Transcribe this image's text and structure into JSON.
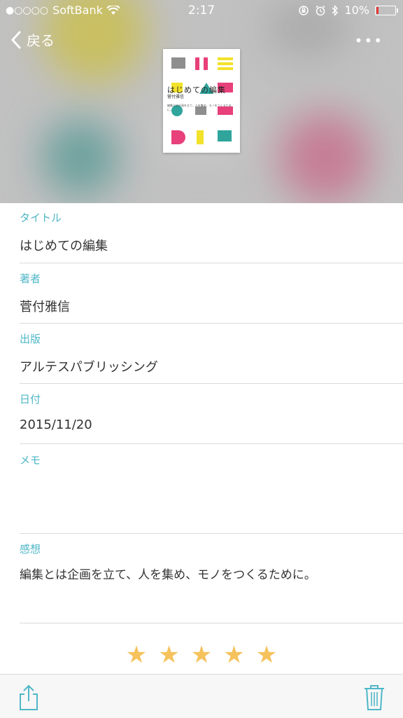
{
  "status_bar": {
    "carrier": "SoftBank",
    "time": "2:17",
    "battery": "10%",
    "battery_level": 0.1,
    "battery_color": "#e53935"
  },
  "nav": {
    "back_label": "戻る",
    "more_label": "•••"
  },
  "cover": {
    "title": "はじめての編集",
    "author": "菅付雅信",
    "caption": "編集とは企画を立て、人を集め、モノをつくるために。"
  },
  "fields": {
    "title": {
      "label": "タイトル",
      "value": "はじめての編集"
    },
    "author": {
      "label": "著者",
      "value": "菅付雅信"
    },
    "publisher": {
      "label": "出版",
      "value": "アルテスパブリッシング"
    },
    "date": {
      "label": "日付",
      "value": "2015/11/20"
    },
    "memo": {
      "label": "メモ",
      "value": ""
    },
    "impression": {
      "label": "感想",
      "value": "編集とは企画を立て、人を集め、モノをつくるために。"
    }
  },
  "rating": {
    "value": 5,
    "max": 5,
    "glyph": "★"
  },
  "colors": {
    "accent": "#4fb7c7",
    "star": "#f5c25c"
  },
  "icons": {
    "share": "share-icon",
    "trash": "trash-icon"
  }
}
